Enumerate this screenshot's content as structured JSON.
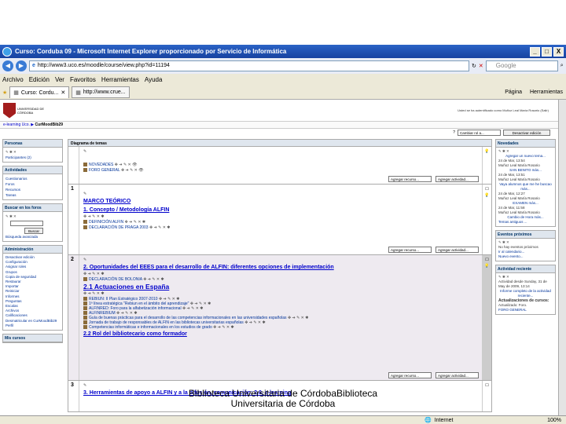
{
  "window": {
    "title": "Curso: Corduba 09 - Microsoft Internet Explorer proporcionado por Servicio de Informática",
    "controls": [
      "_",
      "□",
      "X"
    ]
  },
  "address": {
    "url": "http://www3.uco.es/moodle/course/view.php?id=11194",
    "search_placeholder": "Google"
  },
  "menu": [
    "Archivo",
    "Edición",
    "Ver",
    "Favoritos",
    "Herramientas",
    "Ayuda"
  ],
  "tabs": [
    {
      "label": "Curso: Cordu..."
    },
    {
      "label": "http://www.crue..."
    }
  ],
  "cmdbar": {
    "page": "Página",
    "tools": "Herramientas"
  },
  "page_header": {
    "logo_text": "UNIVERSIDAD DE CÓRDOBA",
    "login_info": "Usted se ha autentificado como Muñoz Leal María Rosario (Salir)"
  },
  "breadcrumb": {
    "root": "e-learning Uco.",
    "current": "CurMoodBib29"
  },
  "toolbar": {
    "role_select": "Cambiar rol a...",
    "edit_button": "Desactivar edición"
  },
  "blocks_left": {
    "personas": {
      "title": "Personas",
      "items": [
        "Participantes (2)"
      ]
    },
    "actividades": {
      "title": "Actividades",
      "items": [
        "Cuestionarios",
        "Foros",
        "Recursos",
        "Tareas"
      ]
    },
    "buscar": {
      "title": "Buscar en los foros",
      "button": "Buscar",
      "advanced": "Búsqueda avanzada"
    },
    "admin": {
      "title": "Administración",
      "items": [
        "Desactivar edición",
        "Configuración",
        "Asignar roles",
        "Grupos",
        "Copia de seguridad",
        "Restaurar",
        "Importar",
        "Reiniciar",
        "Informes",
        "Preguntas",
        "Escalas",
        "Archivos",
        "Calificaciones",
        "Desmatricular en CurMoodBib29",
        "Perfil"
      ]
    },
    "mis_cursos": {
      "title": "Mis cursos"
    }
  },
  "main": {
    "header": "Diagrama de temas",
    "section0": {
      "items": [
        "NOVEDADES",
        "FORO GENERAL"
      ]
    },
    "add_resource": "Agregar recurso...",
    "add_activity": "Agregar actividad...",
    "section1": {
      "num": "1",
      "heading1": "MARCO TEÓRICO",
      "heading2": "1. Concepto / Metodología ALFIN",
      "items": [
        "DEFINICIÓN ALFIN",
        "DECLARACIÓN DE PRAGA 2003"
      ]
    },
    "section2": {
      "num": "2",
      "heading1": "2. Oportunidades del EEES para el desarrollo de ALFIN: diferentes opciones de implementación",
      "item1": "DECLARACIÓN DE BOLONIA",
      "heading2": "2.1 Actuaciones en España",
      "items": [
        "REBIUN: II Plan Estratégico 2007-2010",
        "1ª línea estratégica \"Rebiun en el ámbito del aprendizaje\"",
        "ALFINRED: Foro para la alfabetización informacional",
        "ALFINREBIUM",
        "Guía de buenas prácticas para el desarrollo de las competencias informacionales en las universidades españolas",
        "Jornada de trabajo de responsables de ALFIN en las bibliotecas universitarias españolas",
        "Competencias informáticas e informacionales en los estudios de grado"
      ],
      "heading3": "2.2 Rol del bibliotecario como formador"
    },
    "section3": {
      "num": "3",
      "heading1": "3. Herramientas de apoyo a ALFIN y a la difusión, comunicación: 2.0, e-learning"
    }
  },
  "blocks_right": {
    "novedades": {
      "title": "Novedades",
      "add_link": "Agregar un nuevo tema...",
      "posts": [
        {
          "date": "24 de Mar, 13:54",
          "author": "Muñoz Leal María Rosario",
          "text": "SAN BENITO más..."
        },
        {
          "date": "24 de Mar, 13:51",
          "author": "Muñoz Leal María Rosario",
          "text": "Vaya alumnos que me he buscao más..."
        },
        {
          "date": "24 de Mar, 12:27",
          "author": "Muñoz Leal María Rosario",
          "text": "EXAMEN más..."
        },
        {
          "date": "24 de Mar, 11:58",
          "author": "Muñoz Leal María Rosario",
          "text": "Cambio de Hora más..."
        }
      ],
      "older": "Temas antiguos ..."
    },
    "eventos": {
      "title": "Eventos próximos",
      "empty": "No hay eventos próximos",
      "calendar": "Ir al calendario...",
      "new_event": "Nuevo evento..."
    },
    "actividad": {
      "title": "Actividad reciente",
      "since": "Actividad desde Sunday, 31 de May de 2009, 13:14",
      "report": "Informe completo de la actividad reciente...",
      "updates": "Actualizaciones de cursos:",
      "updated": "Actualizado: Foro.",
      "forum": "FORO GENERAL"
    }
  },
  "status": {
    "zone": "Internet",
    "zoom": "100%"
  },
  "caption": "Biblioteca Universitaria de CórdobaBiblioteca Universitaria de Córdoba"
}
